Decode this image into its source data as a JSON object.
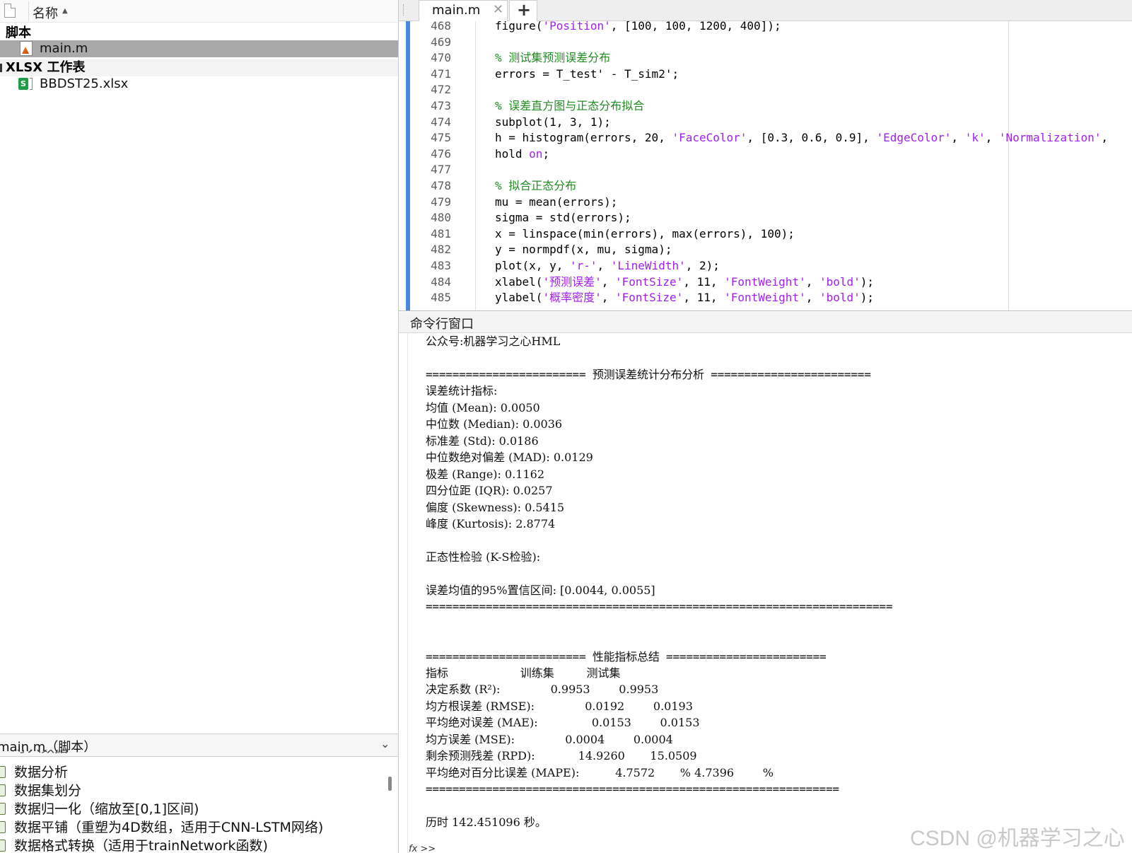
{
  "file_browser": {
    "column_header": "名称",
    "sort_indicator": "▲",
    "groups": [
      {
        "label": "脚本"
      },
      {
        "label": "XLSX 工作表"
      }
    ],
    "files": [
      {
        "label": "main.m"
      },
      {
        "label": "BBDST25.xlsx",
        "icon_text": "S"
      }
    ]
  },
  "details": {
    "title": "main.m（脚本）",
    "chevron": "⌄",
    "sections": [
      "导入数据",
      "数据分析",
      "数据集划分",
      "数据归一化（缩放至[0,1]区间)",
      "数据平铺（重塑为4D数组，适用于CNN-LSTM网络)",
      "数据格式转换（适用于trainNetwork函数)"
    ]
  },
  "editor": {
    "tab_label": "main.m",
    "tab_close": "✕",
    "tab_add": "+",
    "lines": [
      {
        "n": "468",
        "code": "figure('Position', [100, 100, 1200, 400]);"
      },
      {
        "n": "469",
        "code": ""
      },
      {
        "n": "470",
        "code": "% 测试集预测误差分布"
      },
      {
        "n": "471",
        "code": "errors = T_test' - T_sim2';"
      },
      {
        "n": "472",
        "code": ""
      },
      {
        "n": "473",
        "code": "% 误差直方图与正态分布拟合"
      },
      {
        "n": "474",
        "code": "subplot(1, 3, 1);"
      },
      {
        "n": "475",
        "code": "h = histogram(errors, 20, 'FaceColor', [0.3, 0.6, 0.9], 'EdgeColor', 'k', 'Normalization',"
      },
      {
        "n": "476",
        "code": "hold on;"
      },
      {
        "n": "477",
        "code": ""
      },
      {
        "n": "478",
        "code": "% 拟合正态分布"
      },
      {
        "n": "479",
        "code": "mu = mean(errors);"
      },
      {
        "n": "480",
        "code": "sigma = std(errors);"
      },
      {
        "n": "481",
        "code": "x = linspace(min(errors), max(errors), 100);"
      },
      {
        "n": "482",
        "code": "y = normpdf(x, mu, sigma);"
      },
      {
        "n": "483",
        "code": "plot(x, y, 'r-', 'LineWidth', 2);"
      },
      {
        "n": "484",
        "code": "xlabel('预测误差', 'FontSize', 11, 'FontWeight', 'bold');"
      },
      {
        "n": "485",
        "code": "ylabel('概率密度', 'FontSize', 11, 'FontWeight', 'bold');"
      }
    ]
  },
  "command_window": {
    "title": "命令行窗口",
    "prompt": "fx >>",
    "lines": [
      "公众号:机器学习之心HML",
      "",
      "======================== 预测误差统计分布分析 ========================",
      "误差统计指标:",
      "均值 (Mean): 0.0050",
      "中位数 (Median): 0.0036",
      "标准差 (Std): 0.0186",
      "中位数绝对偏差 (MAD): 0.0129",
      "极差 (Range): 0.1162",
      "四分位距 (IQR): 0.0257",
      "偏度 (Skewness): 0.5415",
      "峰度 (Kurtosis): 2.8774",
      "",
      "正态性检验 (K-S检验):",
      "",
      "误差均值的95%置信区间: [0.0044, 0.0055]",
      "======================================================================",
      "",
      "",
      "======================== 性能指标总结 ========================",
      "指标                    训练集         测试集",
      "决定系数 (R²):              0.9953        0.9953",
      "均方根误差 (RMSE):              0.0192        0.0193",
      "平均绝对误差 (MAE):               0.0153        0.0153",
      "均方误差 (MSE):              0.0004        0.0004",
      "剩余预测残差 (RPD):            14.9260       15.0509",
      "平均绝对百分比误差 (MAPE):          4.7572       % 4.7396        %",
      "==============================================================",
      "",
      "历时 142.451096 秒。"
    ]
  },
  "watermark": "CSDN @机器学习之心"
}
